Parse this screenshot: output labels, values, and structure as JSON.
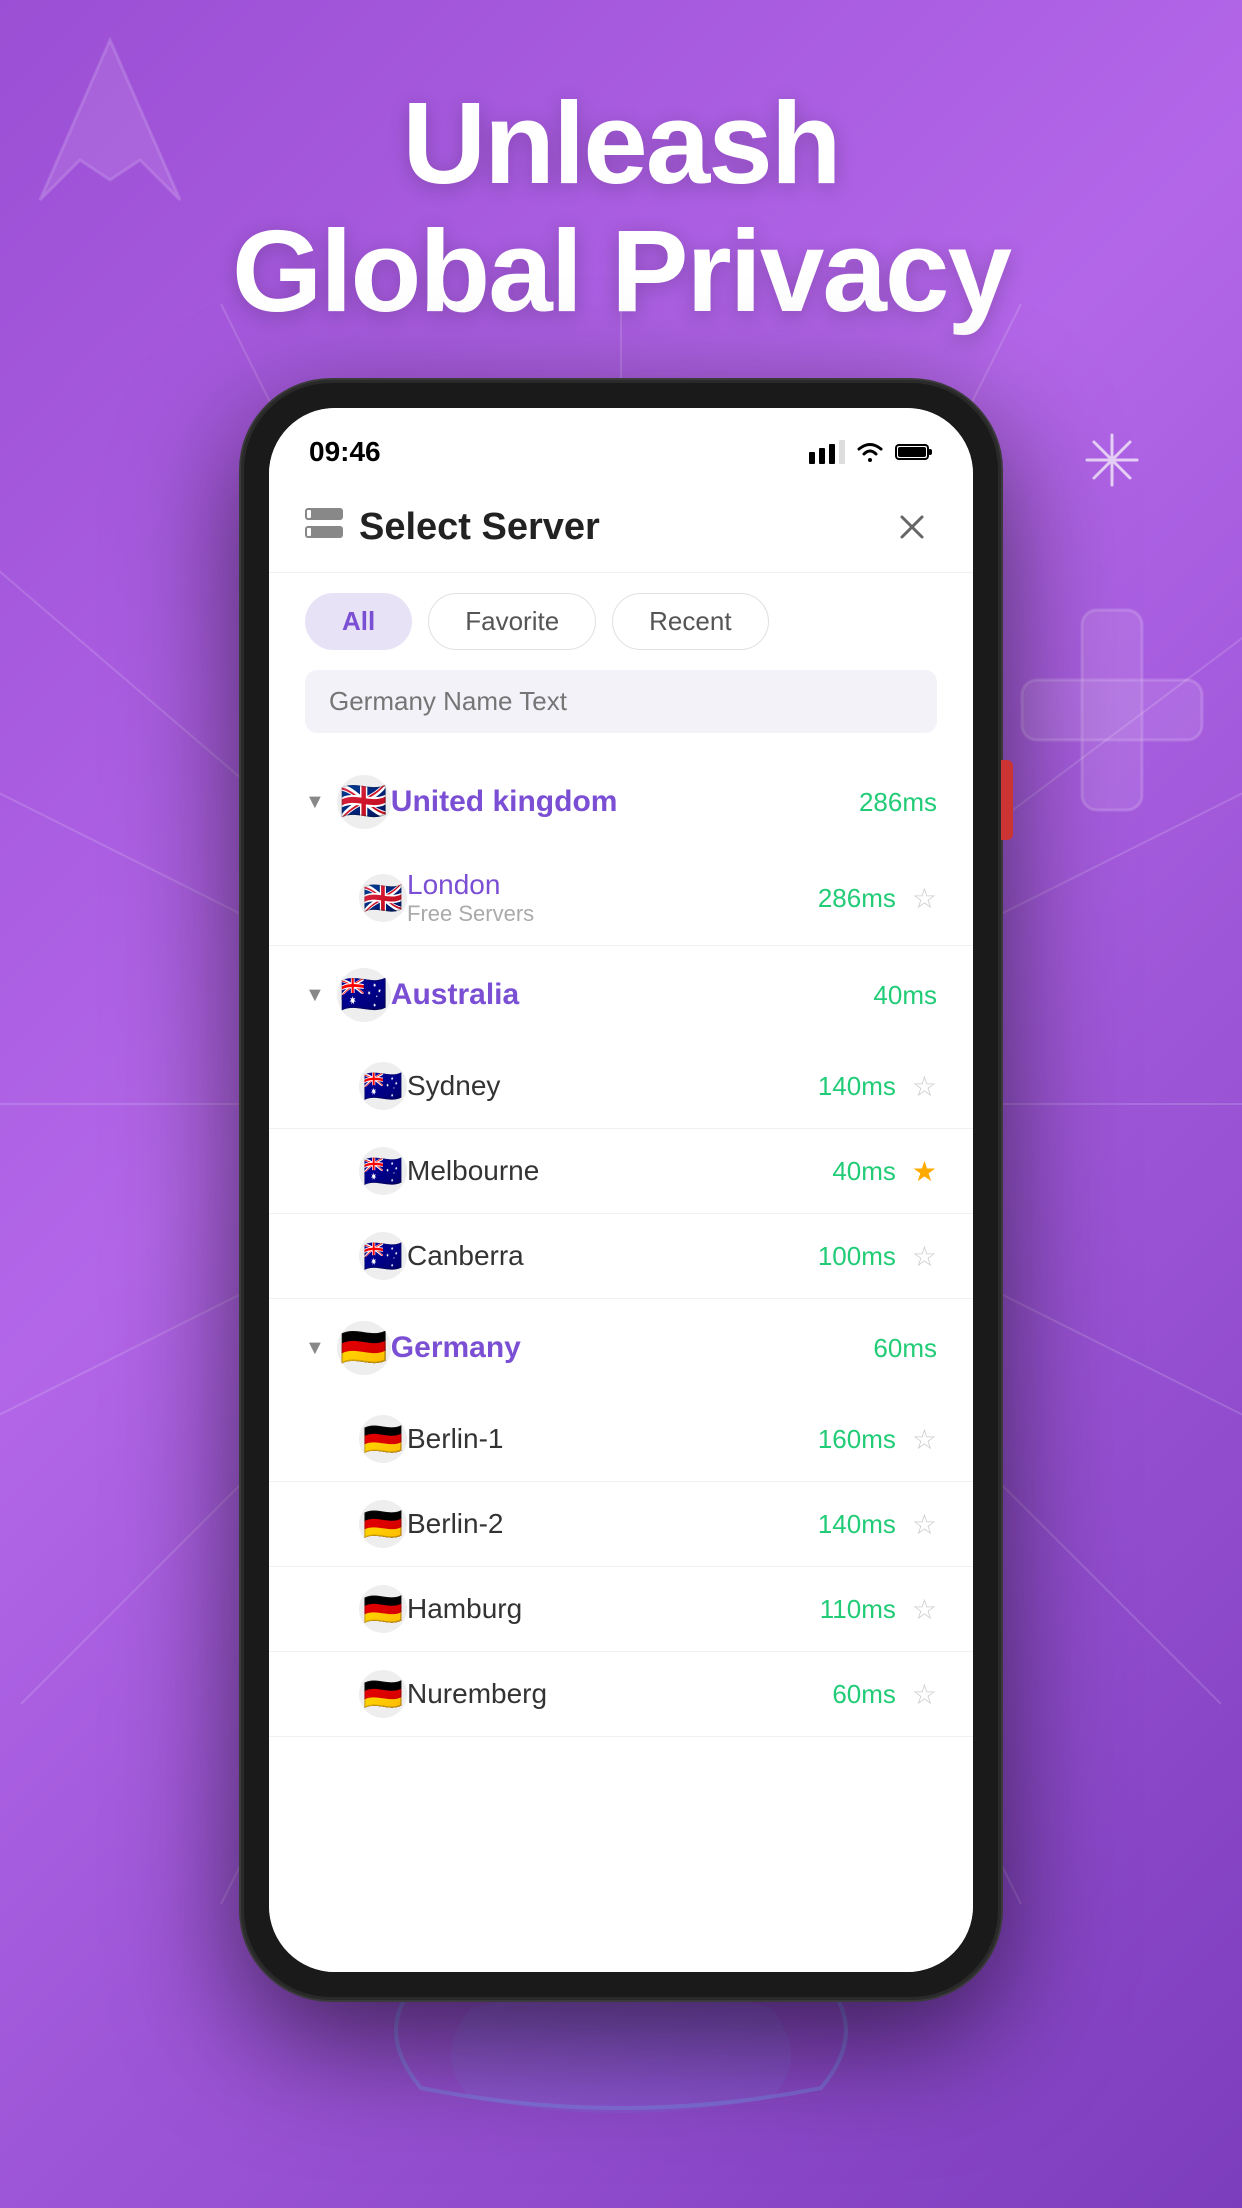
{
  "background": {
    "headline_line1": "Unleash",
    "headline_line2": "Global Privacy"
  },
  "status_bar": {
    "time": "09:46"
  },
  "header": {
    "title": "Select Server",
    "close_label": "×"
  },
  "tabs": [
    {
      "id": "all",
      "label": "All",
      "active": true
    },
    {
      "id": "favorite",
      "label": "Favorite",
      "active": false
    },
    {
      "id": "recent",
      "label": "Recent",
      "active": false
    }
  ],
  "search": {
    "placeholder": "Germany Name Text"
  },
  "countries": [
    {
      "name": "United kingdom",
      "flag": "🇬🇧",
      "latency": "286ms",
      "latency_class": "green",
      "expanded": true,
      "cities": [
        {
          "name": "London",
          "flag": "🇬🇧",
          "subtitle": "Free Servers",
          "latency": "286ms",
          "latency_class": "green",
          "starred": false
        }
      ]
    },
    {
      "name": "Australia",
      "flag": "🇦🇺",
      "latency": "40ms",
      "latency_class": "green",
      "expanded": true,
      "cities": [
        {
          "name": "Sydney",
          "flag": "🇦🇺",
          "subtitle": "",
          "latency": "140ms",
          "latency_class": "green",
          "starred": false
        },
        {
          "name": "Melbourne",
          "flag": "🇦🇺",
          "subtitle": "",
          "latency": "40ms",
          "latency_class": "green",
          "starred": true
        },
        {
          "name": "Canberra",
          "flag": "🇦🇺",
          "subtitle": "",
          "latency": "100ms",
          "latency_class": "green",
          "starred": false
        }
      ]
    },
    {
      "name": "Germany",
      "flag": "🇩🇪",
      "latency": "60ms",
      "latency_class": "green",
      "expanded": true,
      "cities": [
        {
          "name": "Berlin-1",
          "flag": "🇩🇪",
          "subtitle": "",
          "latency": "160ms",
          "latency_class": "green",
          "starred": false
        },
        {
          "name": "Berlin-2",
          "flag": "🇩🇪",
          "subtitle": "",
          "latency": "140ms",
          "latency_class": "green",
          "starred": false
        },
        {
          "name": "Hamburg",
          "flag": "🇩🇪",
          "subtitle": "",
          "latency": "110ms",
          "latency_class": "green",
          "starred": false
        },
        {
          "name": "Nuremberg",
          "flag": "🇩🇪",
          "subtitle": "",
          "latency": "60ms",
          "latency_class": "green",
          "starred": false
        }
      ]
    }
  ]
}
